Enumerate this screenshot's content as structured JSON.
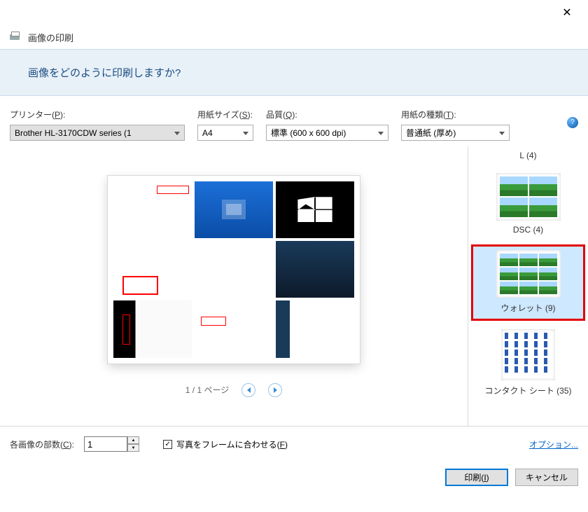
{
  "window": {
    "title": "画像の印刷"
  },
  "banner": {
    "question": "画像をどのように印刷しますか?"
  },
  "controls": {
    "printer": {
      "label_pre": "プリンター(",
      "label_key": "P",
      "label_post": "):",
      "value": "Brother HL-3170CDW series (1"
    },
    "paper_size": {
      "label_pre": "用紙サイズ(",
      "label_key": "S",
      "label_post": "):",
      "value": "A4"
    },
    "quality": {
      "label_pre": "品質(",
      "label_key": "Q",
      "label_post": "):",
      "value": "標準 (600 x 600 dpi)"
    },
    "paper_type": {
      "label_pre": "用紙の種類(",
      "label_key": "T",
      "label_post": "):",
      "value": "普通紙 (厚め)"
    }
  },
  "pager": {
    "text": "1 / 1 ページ"
  },
  "layouts": {
    "l": "L (4)",
    "dsc": "DSC (4)",
    "wallet": "ウォレット (9)",
    "contact": "コンタクト シート (35)"
  },
  "bottom": {
    "copies_label_pre": "各画像の部数(",
    "copies_label_key": "C",
    "copies_label_post": "):",
    "copies_value": "1",
    "fit_label_pre": "写真をフレームに合わせる(",
    "fit_label_key": "F",
    "fit_label_post": ")",
    "options": "オプション..."
  },
  "footer": {
    "print_pre": "印刷(",
    "print_key": "I",
    "print_post": ")",
    "cancel": "キャンセル"
  }
}
